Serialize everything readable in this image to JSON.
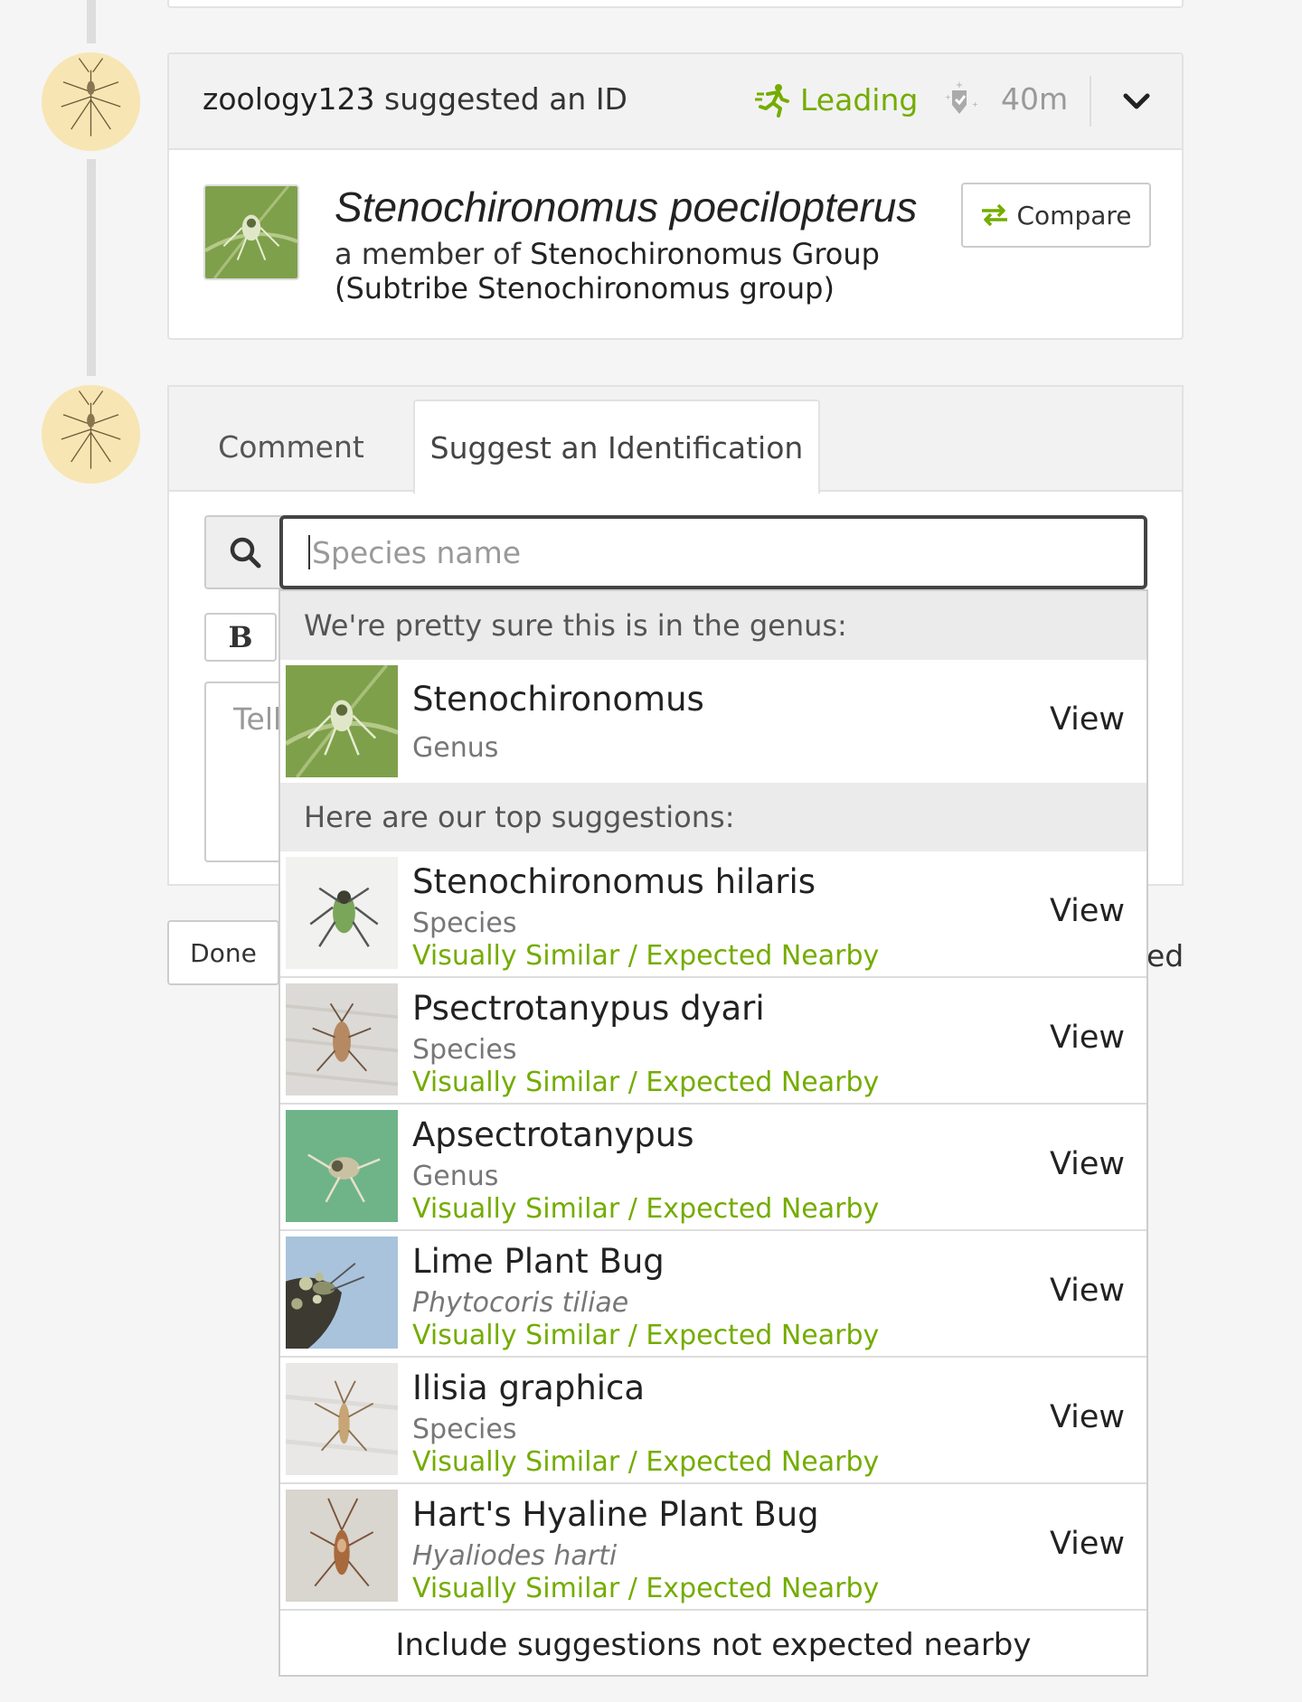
{
  "id_card": {
    "user": "zoology123",
    "action": " suggested an ID",
    "status_label": "Leading",
    "time": "40m",
    "taxon_name": "Stenochironomus poecilopterus",
    "member_prefix": "a member of ",
    "member_group": "Stenochironomus Group",
    "member_subtribe": "(Subtribe Stenochironomus group)",
    "compare_label": "Compare"
  },
  "tabs": {
    "comment": "Comment",
    "suggest": "Suggest an Identification"
  },
  "search": {
    "placeholder": "Species name"
  },
  "editor": {
    "bold_label": "B",
    "textarea_placeholder": "Tell"
  },
  "done_label": "Done",
  "ed_fragment": "ed",
  "dropdown": {
    "genus_header": "We're pretty sure this is in the genus:",
    "genus": {
      "name": "Stenochironomus",
      "rank": "Genus",
      "view": "View"
    },
    "top_header": "Here are our top suggestions:",
    "suggestions": [
      {
        "name": "Stenochironomus hilaris",
        "sub": "Species",
        "tag": "Visually Similar / Expected Nearby",
        "view": "View"
      },
      {
        "name": "Psectrotanypus dyari",
        "sub": "Species",
        "tag": "Visually Similar / Expected Nearby",
        "view": "View"
      },
      {
        "name": "Apsectrotanypus",
        "sub": "Genus",
        "tag": "Visually Similar / Expected Nearby",
        "view": "View"
      },
      {
        "name": "Lime Plant Bug",
        "sub": "Phytocoris tiliae",
        "tag": "Visually Similar / Expected Nearby",
        "view": "View"
      },
      {
        "name": "Ilisia graphica",
        "sub": "Species",
        "tag": "Visually Similar / Expected Nearby",
        "view": "View"
      },
      {
        "name": "Hart's Hyaline Plant Bug",
        "sub": "Hyaliodes harti",
        "tag": "Visually Similar / Expected Nearby",
        "view": "View"
      }
    ],
    "footer": "Include suggestions not expected nearby"
  },
  "colors": {
    "accent_green": "#74ac00",
    "avatar_bg": "#f7e6b3"
  }
}
